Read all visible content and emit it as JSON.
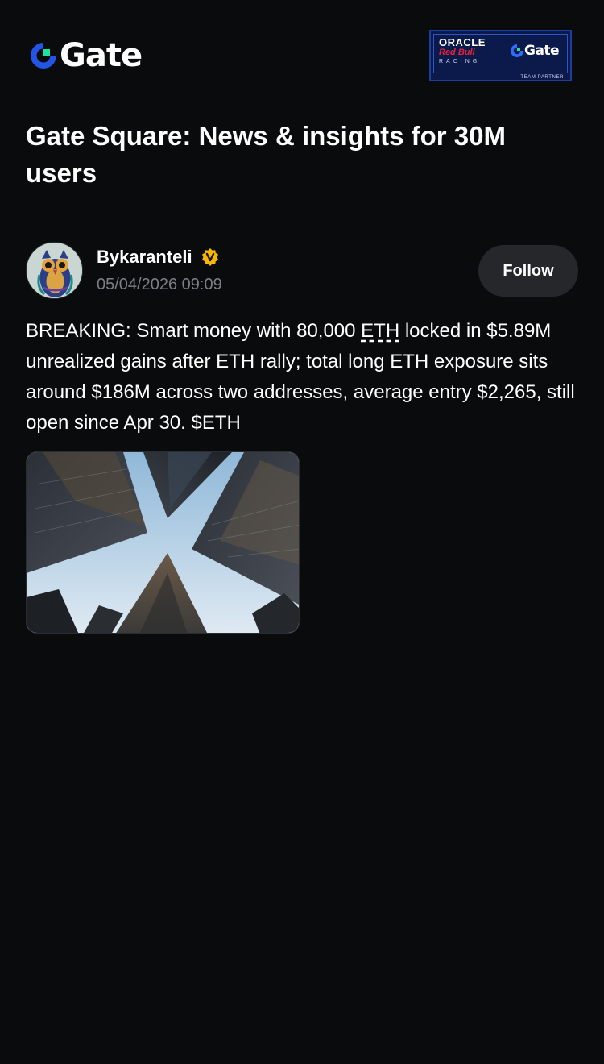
{
  "brand": {
    "name": "Gate",
    "accent": "#2354e6",
    "accent_green": "#17e5a0"
  },
  "partner_badge": {
    "oracle": "ORACLE",
    "red_bull": "Red Bull",
    "racing": "RACING",
    "gate": "Gate",
    "tag": "TEAM PARTNER"
  },
  "page": {
    "title": "Gate Square: News & insights for 30M users"
  },
  "post": {
    "author": {
      "name": "Bykaranteli",
      "verified": true,
      "verified_icon": "verified-badge-icon",
      "badge_color": "#f5b700"
    },
    "timestamp": "05/04/2026 09:09",
    "follow_label": "Follow",
    "body_before": "BREAKING: Smart money with 80,000 ",
    "body_ticker": "ETH",
    "body_after": " locked in $5.89M unrealized gains after ETH rally; total long ETH exposure sits around $186M across two addresses, average entry $2,265, still open since Apr 30. $ETH",
    "image_subject": "skyscrapers-looking-up"
  },
  "colors": {
    "background": "#0a0b0c",
    "text_primary": "#ffffff",
    "text_secondary": "#7c7f84",
    "button_bg": "#25272a"
  }
}
